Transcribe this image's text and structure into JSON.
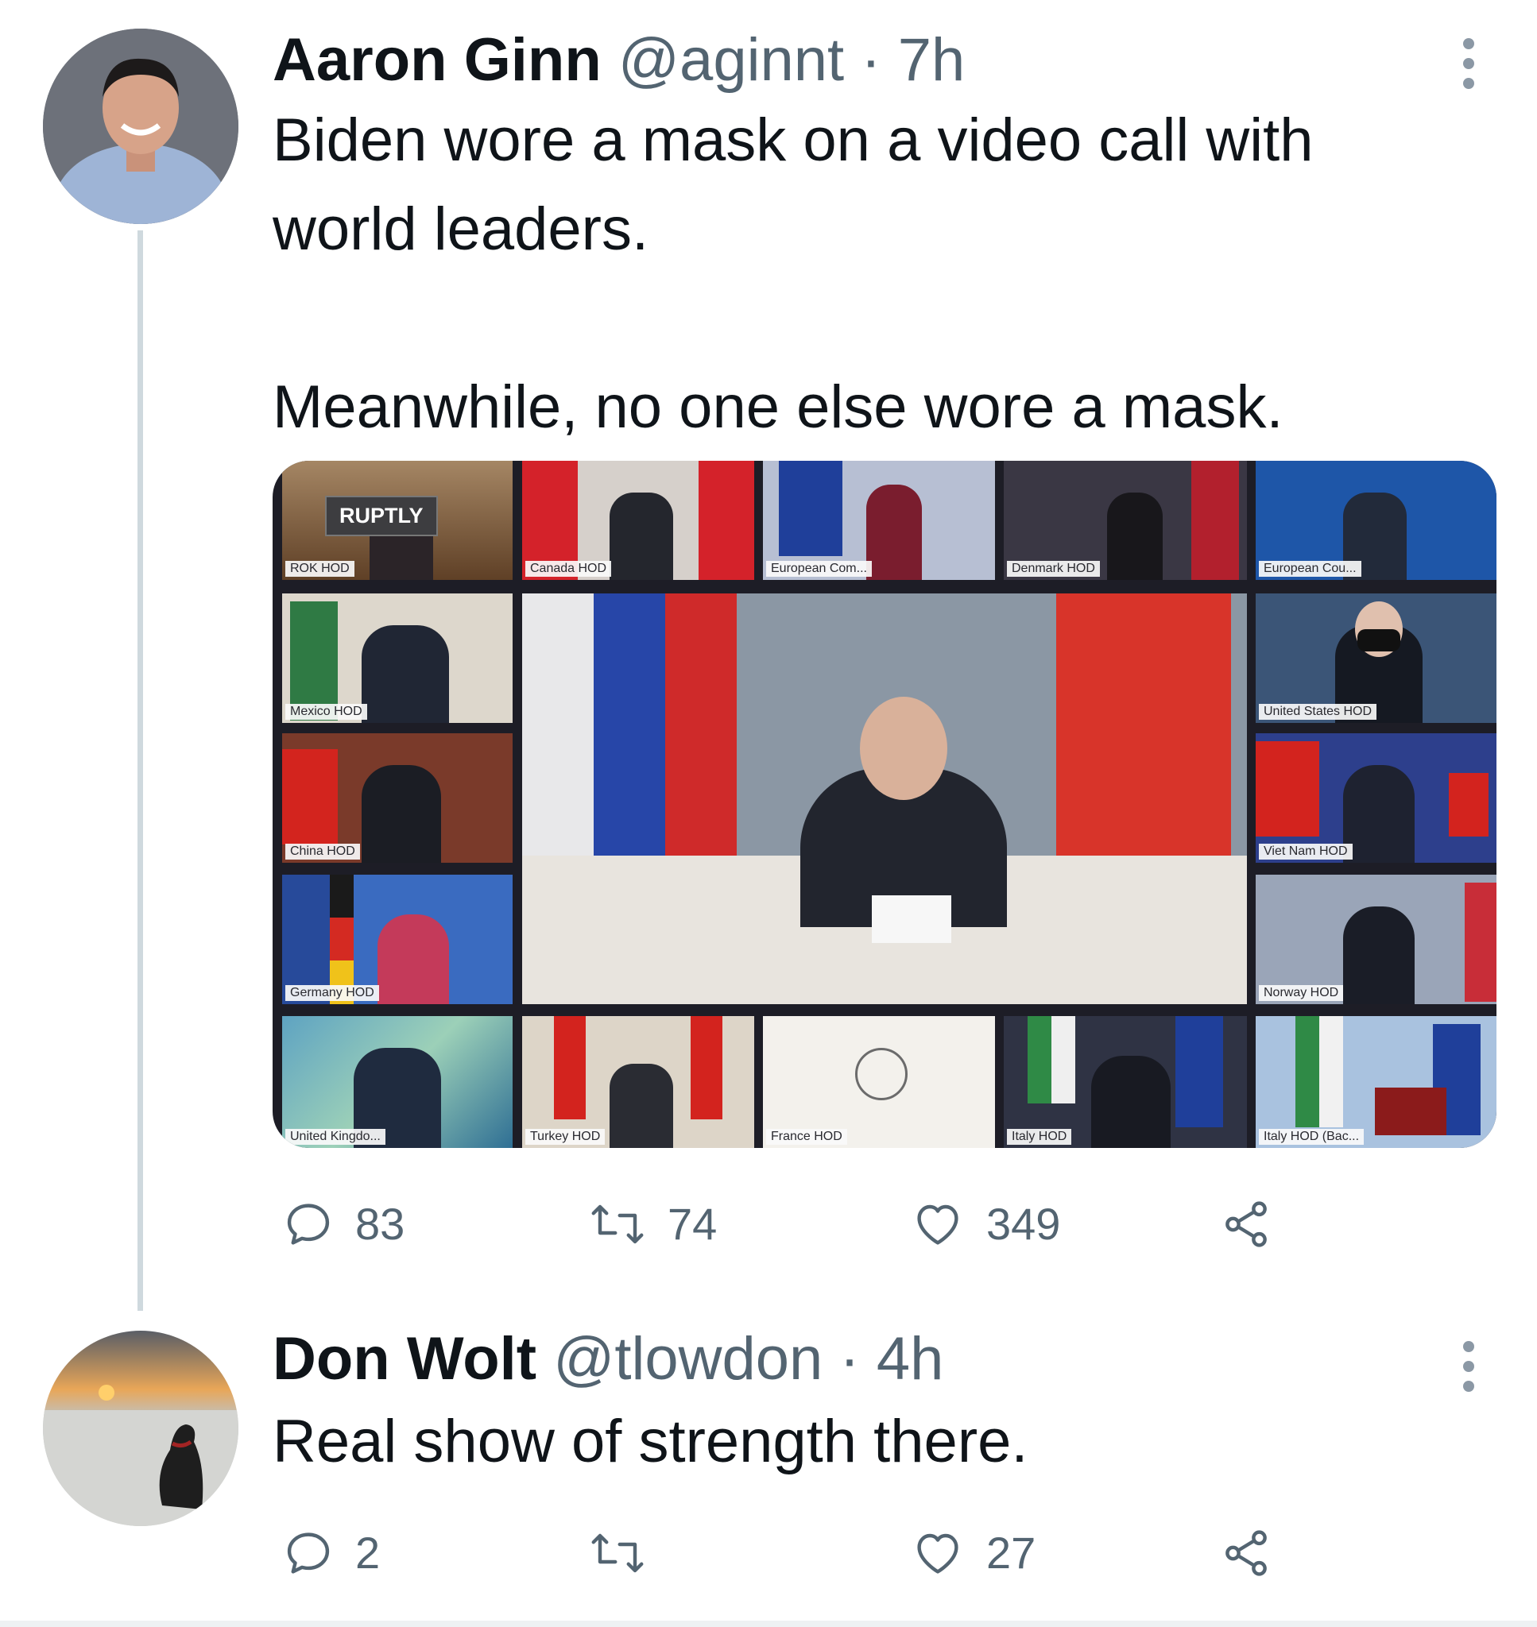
{
  "tweets": [
    {
      "name": "Aaron Ginn",
      "handle": "@aginnt",
      "time": "· 7h",
      "text": "Biden wore a mask on a video call with\nworld leaders.\n\nMeanwhile, no one else wore a mask.",
      "replies": "83",
      "retweets": "74",
      "likes": "349"
    },
    {
      "name": "Don Wolt",
      "handle": "@tlowdon",
      "time": "· 4h",
      "text": "Real show of strength there.",
      "replies": "2",
      "retweets": "",
      "likes": "27"
    }
  ],
  "media": {
    "watermark": "RUPTLY",
    "tiles": [
      {
        "label": "ROK HOD",
        "bg": "#7a5a3a"
      },
      {
        "label": "Canada HOD",
        "bg": "#c9c4c0"
      },
      {
        "label": "European Com...",
        "bg": "#aab3c8"
      },
      {
        "label": "Denmark HOD",
        "bg": "#3b3842"
      },
      {
        "label": "European Cou...",
        "bg": "#1d4f9c"
      },
      {
        "label": "Mexico HOD",
        "bg": "#d8d2c6"
      },
      {
        "label": "United States HOD",
        "bg": "#2f4c72"
      },
      {
        "label": "China HOD",
        "bg": "#8e3b2a"
      },
      {
        "label": "Viet Nam HOD",
        "bg": "#2a3f8f"
      },
      {
        "label": "Germany HOD",
        "bg": "#3563b5"
      },
      {
        "label": "Norway HOD",
        "bg": "#8b98ad"
      },
      {
        "label": "United Kingdo...",
        "bg": "#4d86a8"
      },
      {
        "label": "Turkey HOD",
        "bg": "#d7cfc2"
      },
      {
        "label": "France HOD",
        "bg": "#f3f1ec"
      },
      {
        "label": "Italy HOD",
        "bg": "#2e3140"
      },
      {
        "label": "Italy HOD (Bac...",
        "bg": "#9fb8d8"
      }
    ]
  },
  "colors": {
    "meta": "#536471",
    "thread_line": "#cfd9de",
    "icon": "#536471"
  },
  "icons": [
    "reply-icon",
    "retweet-icon",
    "like-icon",
    "share-icon",
    "more-icon"
  ]
}
